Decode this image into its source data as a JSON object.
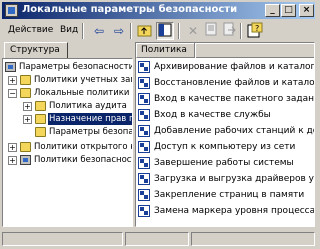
{
  "window": {
    "title": "Локальные параметры безопасности",
    "minimize": "_",
    "maximize": "□",
    "close": "×"
  },
  "menu": {
    "action": "Действие",
    "view": "Вид"
  },
  "toolbar": {
    "back_icon": "back-arrow-icon",
    "forward_icon": "forward-arrow-icon"
  },
  "left_pane": {
    "tab_label": "Структура",
    "tree": [
      {
        "label": "Параметры безопасности",
        "level": 0,
        "icon": "computer-icon"
      },
      {
        "label": "Политики учетных записей",
        "level": 1,
        "icon": "folder-icon",
        "expander": "+"
      },
      {
        "label": "Локальные политики",
        "level": 1,
        "icon": "folder-icon",
        "expander": "−"
      },
      {
        "label": "Политика аудита",
        "level": 2,
        "icon": "folder-icon",
        "expander": "+"
      },
      {
        "label": "Назначение прав пользователя",
        "level": 2,
        "icon": "folder-icon",
        "expander": "+",
        "selected": true
      },
      {
        "label": "Параметры безопасности",
        "level": 2,
        "icon": "folder-icon"
      },
      {
        "label": "Политики открытого ключа",
        "level": 1,
        "icon": "folder-icon",
        "expander": "+"
      },
      {
        "label": "Политики безопасности IP",
        "level": 1,
        "icon": "computer-icon",
        "expander": "+"
      }
    ]
  },
  "right_pane": {
    "column_header": "Политика",
    "rows": [
      "Архивирование файлов и каталогов",
      "Восстановление файлов и каталогов",
      "Вход в качестве пакетного задания",
      "Вход в качестве службы",
      "Добавление рабочих станций к домену",
      "Доступ к компьютеру из сети",
      "Завершение работы системы",
      "Загрузка и выгрузка драйверов устройств",
      "Закрепление страниц в памяти",
      "Замена маркера уровня процесса"
    ]
  }
}
